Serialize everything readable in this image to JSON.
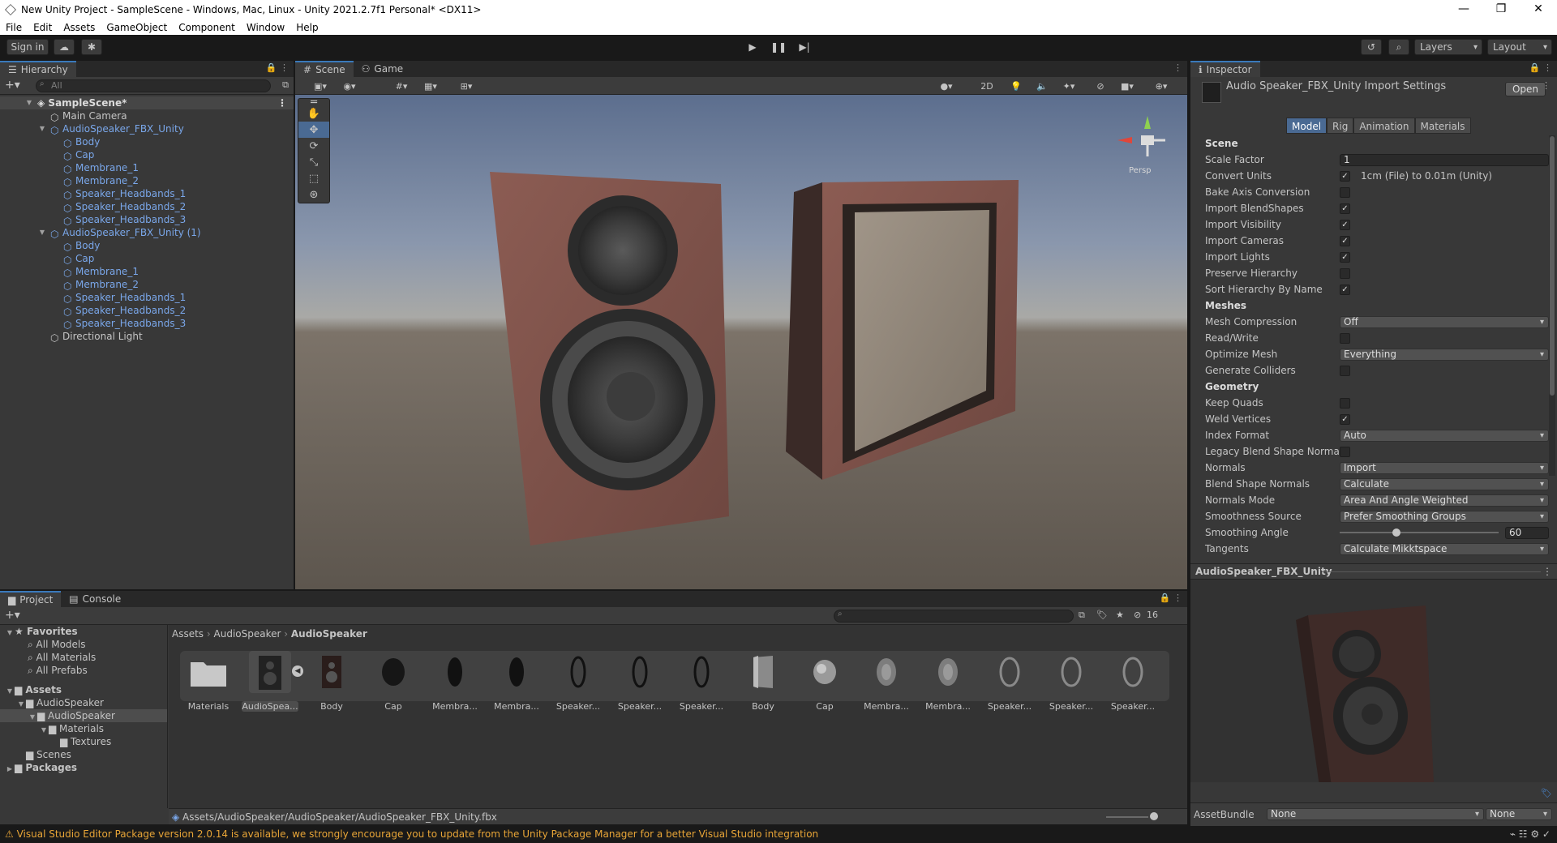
{
  "window": {
    "title": "New Unity Project - SampleScene - Windows, Mac, Linux - Unity 2021.2.7f1 Personal* <DX11>",
    "minimize": "—",
    "maximize": "❐",
    "close": "✕"
  },
  "menu": [
    "File",
    "Edit",
    "Assets",
    "GameObject",
    "Component",
    "Window",
    "Help"
  ],
  "toolbar": {
    "sign_in": "Sign in",
    "layers": "Layers",
    "layout": "Layout"
  },
  "hierarchy": {
    "tab": "Hierarchy",
    "search_placeholder": "All",
    "scene": "SampleScene*",
    "items": [
      {
        "label": "Main Camera",
        "depth": 1,
        "prefab": false,
        "arrow": ""
      },
      {
        "label": "AudioSpeaker_FBX_Unity",
        "depth": 1,
        "prefab": true,
        "arrow": "▼"
      },
      {
        "label": "Body",
        "depth": 2,
        "prefab": true,
        "arrow": ""
      },
      {
        "label": "Cap",
        "depth": 2,
        "prefab": true,
        "arrow": ""
      },
      {
        "label": "Membrane_1",
        "depth": 2,
        "prefab": true,
        "arrow": ""
      },
      {
        "label": "Membrane_2",
        "depth": 2,
        "prefab": true,
        "arrow": ""
      },
      {
        "label": "Speaker_Headbands_1",
        "depth": 2,
        "prefab": true,
        "arrow": ""
      },
      {
        "label": "Speaker_Headbands_2",
        "depth": 2,
        "prefab": true,
        "arrow": ""
      },
      {
        "label": "Speaker_Headbands_3",
        "depth": 2,
        "prefab": true,
        "arrow": ""
      },
      {
        "label": "AudioSpeaker_FBX_Unity (1)",
        "depth": 1,
        "prefab": true,
        "arrow": "▼"
      },
      {
        "label": "Body",
        "depth": 2,
        "prefab": true,
        "arrow": ""
      },
      {
        "label": "Cap",
        "depth": 2,
        "prefab": true,
        "arrow": ""
      },
      {
        "label": "Membrane_1",
        "depth": 2,
        "prefab": true,
        "arrow": ""
      },
      {
        "label": "Membrane_2",
        "depth": 2,
        "prefab": true,
        "arrow": ""
      },
      {
        "label": "Speaker_Headbands_1",
        "depth": 2,
        "prefab": true,
        "arrow": ""
      },
      {
        "label": "Speaker_Headbands_2",
        "depth": 2,
        "prefab": true,
        "arrow": ""
      },
      {
        "label": "Speaker_Headbands_3",
        "depth": 2,
        "prefab": true,
        "arrow": ""
      },
      {
        "label": "Directional Light",
        "depth": 1,
        "prefab": false,
        "arrow": ""
      }
    ]
  },
  "scene_view": {
    "tabs": [
      "Scene",
      "Game"
    ],
    "mode_2d": "2D",
    "gizmo_label": "Persp"
  },
  "inspector": {
    "tab": "Inspector",
    "title": "Audio Speaker_FBX_Unity Import Settings",
    "open_button": "Open",
    "tabs": [
      "Model",
      "Rig",
      "Animation",
      "Materials"
    ],
    "props": [
      {
        "label": "Scene",
        "kind": "header"
      },
      {
        "label": "Scale Factor",
        "kind": "text",
        "value": "1"
      },
      {
        "label": "Convert Units",
        "kind": "check",
        "checked": true,
        "extra": "1cm (File) to 0.01m (Unity)"
      },
      {
        "label": "Bake Axis Conversion",
        "kind": "check",
        "checked": false
      },
      {
        "label": "Import BlendShapes",
        "kind": "check",
        "checked": true
      },
      {
        "label": "Import Visibility",
        "kind": "check",
        "checked": true
      },
      {
        "label": "Import Cameras",
        "kind": "check",
        "checked": true
      },
      {
        "label": "Import Lights",
        "kind": "check",
        "checked": true
      },
      {
        "label": "Preserve Hierarchy",
        "kind": "check",
        "checked": false
      },
      {
        "label": "Sort Hierarchy By Name",
        "kind": "check",
        "checked": true
      },
      {
        "label": "Meshes",
        "kind": "header"
      },
      {
        "label": "Mesh Compression",
        "kind": "dropdown",
        "value": "Off"
      },
      {
        "label": "Read/Write",
        "kind": "check",
        "checked": false
      },
      {
        "label": "Optimize Mesh",
        "kind": "dropdown",
        "value": "Everything"
      },
      {
        "label": "Generate Colliders",
        "kind": "check",
        "checked": false
      },
      {
        "label": "Geometry",
        "kind": "header"
      },
      {
        "label": "Keep Quads",
        "kind": "check",
        "checked": false
      },
      {
        "label": "Weld Vertices",
        "kind": "check",
        "checked": true
      },
      {
        "label": "Index Format",
        "kind": "dropdown",
        "value": "Auto"
      },
      {
        "label": "Legacy Blend Shape Normals",
        "kind": "check",
        "checked": false
      },
      {
        "label": "Normals",
        "kind": "dropdown",
        "value": "Import"
      },
      {
        "label": "Blend Shape Normals",
        "kind": "dropdown",
        "value": "Calculate"
      },
      {
        "label": "Normals Mode",
        "kind": "dropdown",
        "value": "Area And Angle Weighted"
      },
      {
        "label": "Smoothness Source",
        "kind": "dropdown",
        "value": "Prefer Smoothing Groups"
      },
      {
        "label": "Smoothing Angle",
        "kind": "slider",
        "value": "60",
        "fraction": 0.33
      },
      {
        "label": "Tangents",
        "kind": "dropdown",
        "value": "Calculate Mikktspace"
      }
    ],
    "preview_title": "AudioSpeaker_FBX_Unity",
    "asset_bundle_label": "AssetBundle",
    "asset_bundle_value": "None",
    "asset_variant_value": "None"
  },
  "project": {
    "tabs": [
      "Project",
      "Console"
    ],
    "favorites_label": "Favorites",
    "favorites": [
      "All Models",
      "All Materials",
      "All Prefabs"
    ],
    "assets_label": "Assets",
    "tree": [
      {
        "label": "AudioSpeaker",
        "depth": 1
      },
      {
        "label": "AudioSpeaker",
        "depth": 2,
        "selected": true
      },
      {
        "label": "Materials",
        "depth": 3
      },
      {
        "label": "Textures",
        "depth": 4
      },
      {
        "label": "Scenes",
        "depth": 1
      }
    ],
    "packages_label": "Packages",
    "breadcrumb": [
      "Assets",
      "AudioSpeaker",
      "AudioSpeaker"
    ],
    "hidden_count": "16",
    "items": [
      {
        "name": "Materials",
        "type": "folder"
      },
      {
        "name": "AudioSpea...",
        "type": "model",
        "selected": true
      },
      {
        "name": "Body",
        "type": "body"
      },
      {
        "name": "Cap",
        "type": "cap"
      },
      {
        "name": "Membra...",
        "type": "membrane"
      },
      {
        "name": "Membra...",
        "type": "membrane"
      },
      {
        "name": "Speaker...",
        "type": "ring"
      },
      {
        "name": "Speaker...",
        "type": "ring"
      },
      {
        "name": "Speaker...",
        "type": "ring"
      },
      {
        "name": "Body",
        "type": "mesh-body"
      },
      {
        "name": "Cap",
        "type": "mesh-cap"
      },
      {
        "name": "Membra...",
        "type": "mesh-membrane"
      },
      {
        "name": "Membra...",
        "type": "mesh-membrane"
      },
      {
        "name": "Speaker...",
        "type": "mesh-ring"
      },
      {
        "name": "Speaker...",
        "type": "mesh-ring"
      },
      {
        "name": "Speaker...",
        "type": "mesh-ring"
      }
    ],
    "path": "Assets/AudioSpeaker/AudioSpeaker/AudioSpeaker_FBX_Unity.fbx"
  },
  "status": {
    "message": "Visual Studio Editor Package version 2.0.14 is available, we strongly encourage you to update from the Unity Package Manager for a better Visual Studio integration"
  }
}
